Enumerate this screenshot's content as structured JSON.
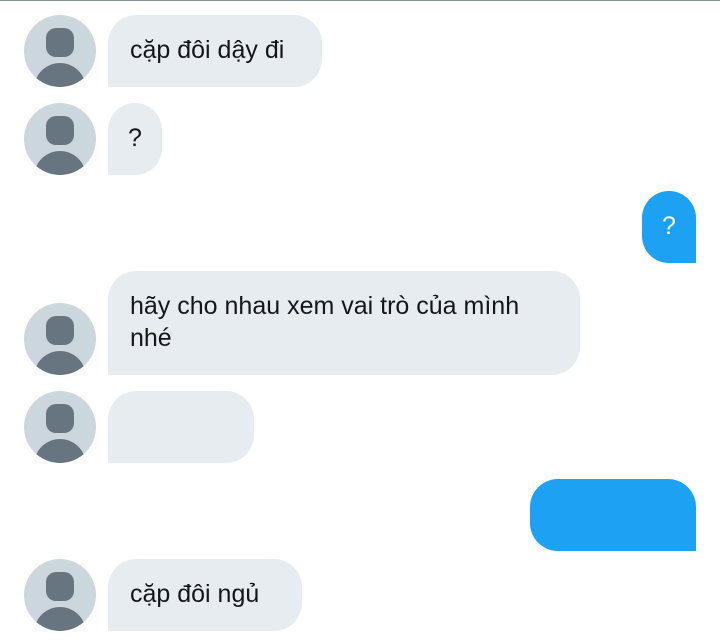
{
  "messages": [
    {
      "direction": "incoming",
      "text": "cặp đôi dậy đi"
    },
    {
      "direction": "incoming",
      "text": "?"
    },
    {
      "direction": "outgoing",
      "text": "?"
    },
    {
      "direction": "incoming",
      "text": "hãy cho nhau xem vai trò của mình nhé"
    },
    {
      "direction": "incoming",
      "text": ""
    },
    {
      "direction": "outgoing",
      "text": ""
    },
    {
      "direction": "incoming",
      "text": "cặp đôi ngủ"
    }
  ],
  "colors": {
    "incoming_bubble": "#e6ecf0",
    "outgoing_bubble": "#1da1f2",
    "avatar_bg": "#ccd6dd",
    "avatar_figure": "#66757f"
  },
  "icons": {
    "avatar": "default-profile-avatar-icon"
  }
}
